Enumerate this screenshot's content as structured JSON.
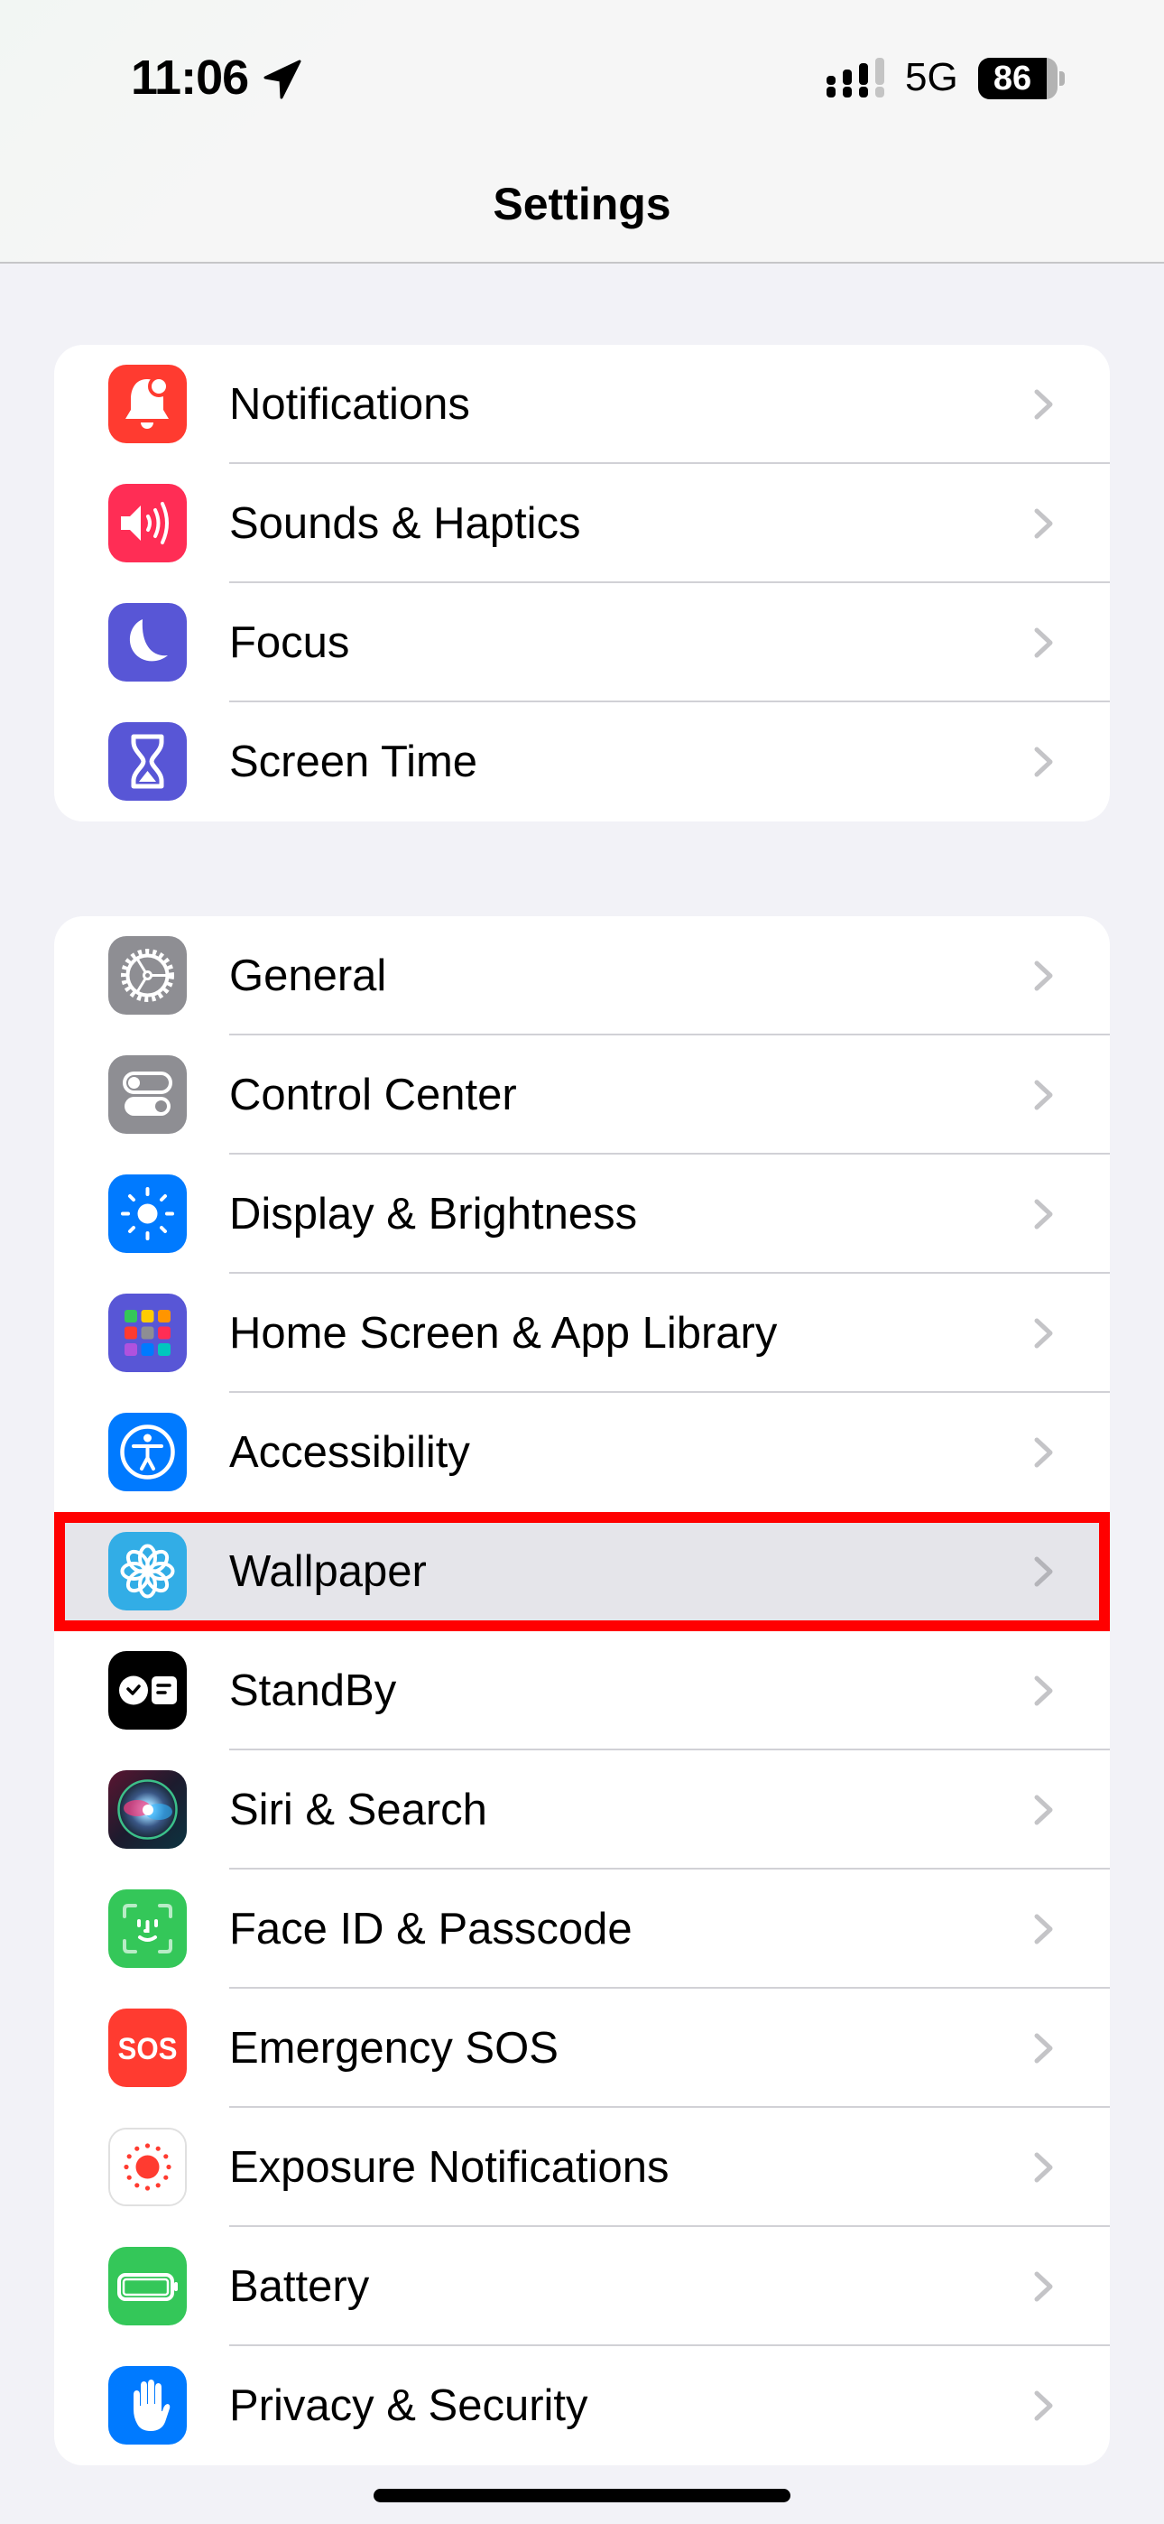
{
  "status_bar": {
    "time": "11:06",
    "location_icon": "location-arrow-icon",
    "signal_bars_active": 3,
    "signal_bars_total": 4,
    "network": "5G",
    "battery_percent": 86
  },
  "nav": {
    "title": "Settings"
  },
  "groups": [
    {
      "items": [
        {
          "label": "Notifications",
          "icon": "bell-icon",
          "icon_color": "#FF3B30"
        },
        {
          "label": "Sounds & Haptics",
          "icon": "speaker-icon",
          "icon_color": "#FF2D55"
        },
        {
          "label": "Focus",
          "icon": "moon-icon",
          "icon_color": "#5856D6"
        },
        {
          "label": "Screen Time",
          "icon": "hourglass-icon",
          "icon_color": "#5856D6"
        }
      ]
    },
    {
      "items": [
        {
          "label": "General",
          "icon": "gear-icon",
          "icon_color": "#8E8E93"
        },
        {
          "label": "Control Center",
          "icon": "toggles-icon",
          "icon_color": "#8E8E93"
        },
        {
          "label": "Display & Brightness",
          "icon": "sun-icon",
          "icon_color": "#007AFF"
        },
        {
          "label": "Home Screen & App Library",
          "icon": "app-grid-icon",
          "icon_color": "#5856D6"
        },
        {
          "label": "Accessibility",
          "icon": "accessibility-icon",
          "icon_color": "#007AFF"
        },
        {
          "label": "Wallpaper",
          "icon": "flower-icon",
          "icon_color": "#32ADE6",
          "highlighted": true
        },
        {
          "label": "StandBy",
          "icon": "standby-icon",
          "icon_color": "#000000"
        },
        {
          "label": "Siri & Search",
          "icon": "siri-icon",
          "icon_color": "#2A1A2E"
        },
        {
          "label": "Face ID & Passcode",
          "icon": "face-id-icon",
          "icon_color": "#34C759"
        },
        {
          "label": "Emergency SOS",
          "icon": "sos-icon",
          "icon_color": "#FF3B30",
          "icon_text": "SOS"
        },
        {
          "label": "Exposure Notifications",
          "icon": "exposure-icon",
          "icon_color": "#FFFFFF"
        },
        {
          "label": "Battery",
          "icon": "battery-icon",
          "icon_color": "#34C759"
        },
        {
          "label": "Privacy & Security",
          "icon": "hand-icon",
          "icon_color": "#007AFF"
        }
      ]
    }
  ],
  "highlight": {
    "target": "Wallpaper",
    "color": "#FF0000"
  }
}
